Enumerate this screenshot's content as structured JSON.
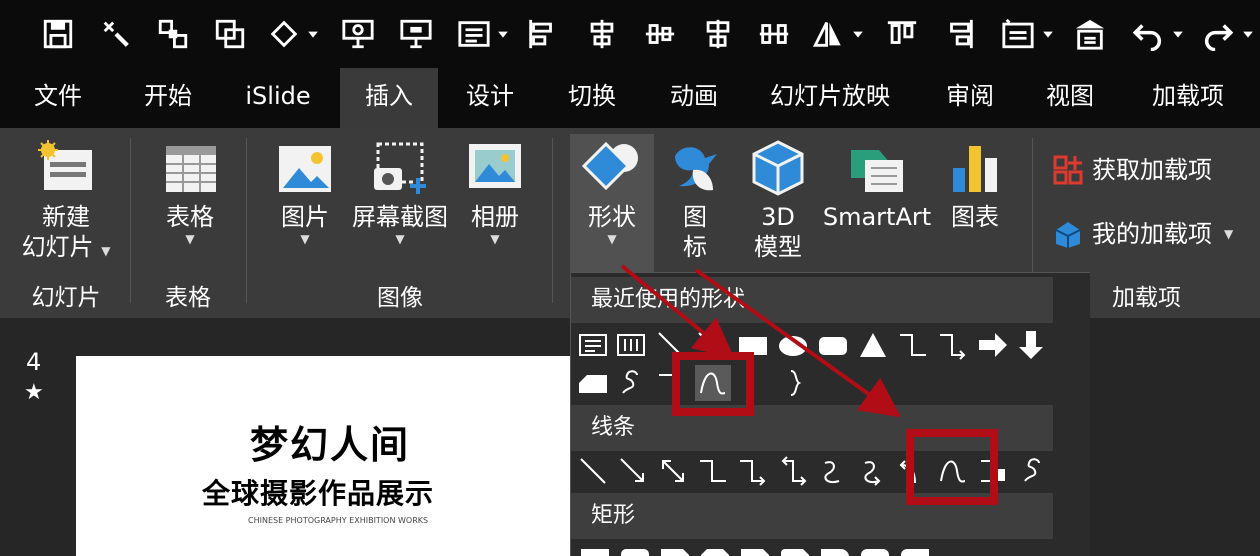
{
  "tabs": [
    "文件",
    "开始",
    "iSlide",
    "插入",
    "设计",
    "切换",
    "动画",
    "幻灯片放映",
    "审阅",
    "视图",
    "加载项"
  ],
  "active_tab": "插入",
  "qat_icons": [
    "save-icon",
    "format-painter-icon",
    "group-icon",
    "ungroup-icon",
    "shape-outline-icon",
    "slideshow-icon",
    "present-icon",
    "text-box-icon",
    "align-left-icon",
    "align-center-icon",
    "distribute-h-icon",
    "align-middle-icon",
    "distribute-v-icon",
    "flip-icon",
    "align-top-icon",
    "align-right-icon",
    "new-slide-icon",
    "layout-icon",
    "undo-icon",
    "redo-icon"
  ],
  "ribbon": {
    "new_slide": {
      "line1": "新建",
      "line2": "幻灯片"
    },
    "table": "表格",
    "picture": "图片",
    "screenshot": "屏幕截图",
    "album": "相册",
    "shapes": "形状",
    "icons": {
      "line1": "图",
      "line2": "标"
    },
    "model3d": {
      "line1": "3D",
      "line2": "模型"
    },
    "smartart": "SmartArt",
    "chart": "图表",
    "get_addins": "获取加载项",
    "my_addins": "我的加载项",
    "groups": {
      "slides": "幻灯片",
      "tables": "表格",
      "images": "图像",
      "addins": "加载项"
    }
  },
  "panel": {
    "recent": "最近使用的形状",
    "lines": "线条",
    "rect": "矩形"
  },
  "slide": {
    "number": "4",
    "star": "★",
    "title": "梦幻人间",
    "subtitle": "全球摄影作品展示",
    "caption": "CHINESE PHOTOGRAPHY EXHIBITION WORKS"
  },
  "colors": {
    "highlight": "#b00d16",
    "accent_blue": "#2f8bd8",
    "ribbon_bg": "#3b3b3b"
  }
}
